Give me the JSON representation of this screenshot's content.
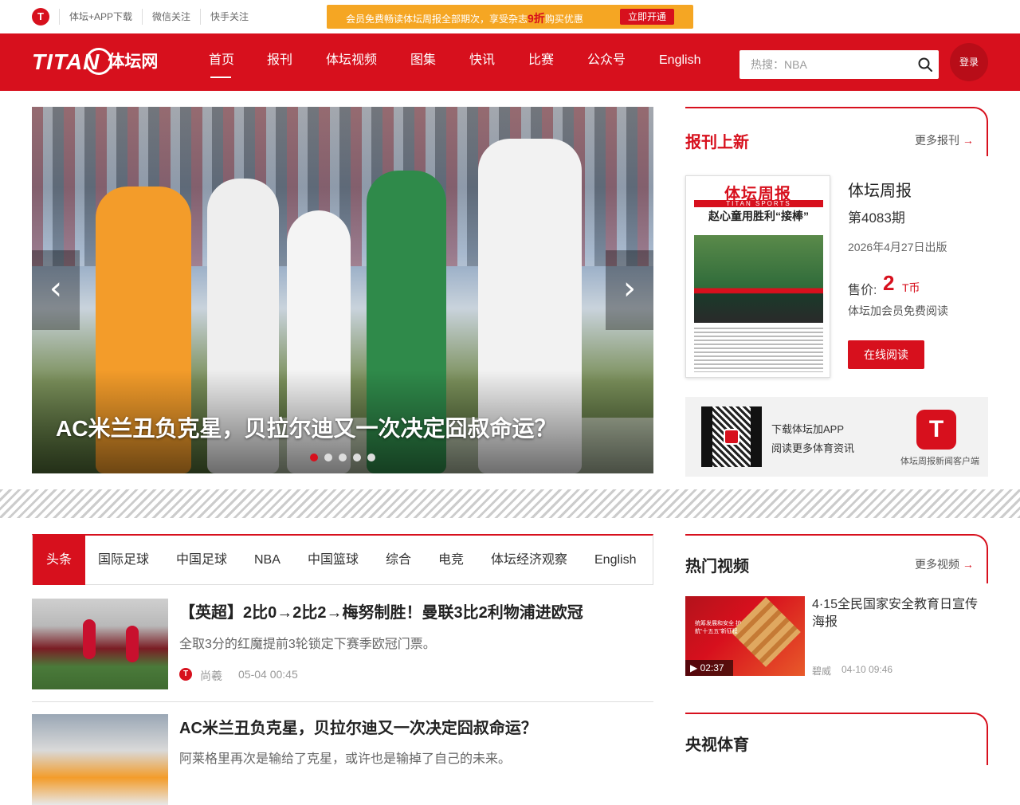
{
  "topbar": {
    "links": [
      "体坛+APP下载",
      "微信关注",
      "快手关注"
    ],
    "promo": {
      "text_before": "会员免费畅读体坛周报全部期次，享受杂志",
      "highlight": "9折",
      "text_after": "购买优惠",
      "button": "立即开通"
    }
  },
  "header": {
    "logo_en": "TITAN",
    "logo_cn": "体坛网",
    "nav": [
      "首页",
      "报刊",
      "体坛视频",
      "图集",
      "快讯",
      "比赛",
      "公众号",
      "English"
    ],
    "active_nav": "首页",
    "search_placeholder": "热搜：NBA",
    "login": "登录"
  },
  "hero": {
    "title": "AC米兰丑负克星，贝拉尔迪又一次决定囧叔命运？",
    "prev_arrow": "‹",
    "next_arrow": "›",
    "slide_count": 5,
    "active_slide": 1
  },
  "magazine_panel": {
    "title": "报刊上新",
    "more": "更多报刊",
    "cover": {
      "masthead": "体坛周报",
      "sub": "TITAN SPORTS",
      "headline": "赵心童用胜利“接棒”"
    },
    "name": "体坛周报",
    "issue": "第4083期",
    "date": "2026年4月27日出版",
    "price_label": "售价:",
    "price": "2",
    "price_unit": "T币",
    "free_note": "体坛加会员免费阅读",
    "read_button": "在线阅读"
  },
  "app_promo": {
    "line1": "下载体坛加APP",
    "line2": "阅读更多体育资讯",
    "icon_letter": "T",
    "caption": "体坛周报新闻客户端"
  },
  "tabs": [
    "头条",
    "国际足球",
    "中国足球",
    "NBA",
    "中国篮球",
    "综合",
    "电竞",
    "体坛经济观察",
    "English"
  ],
  "articles": [
    {
      "title": "【英超】2比0→2比2→梅努制胜！曼联3比2利物浦进欧冠",
      "summary": "全取3分的红魔提前3轮锁定下赛季欧冠门票。",
      "author": "尚羲",
      "time": "05-04 00:45"
    },
    {
      "title": "AC米兰丑负克星，贝拉尔迪又一次决定囧叔命运？",
      "summary": "阿莱格里再次是输给了克星，或许也是输掉了自己的未来。"
    }
  ],
  "video_panel": {
    "title": "热门视频",
    "more": "更多视频",
    "item": {
      "title": "4·15全民国家安全教育日宣传海报",
      "duration": "02:37",
      "author": "碧威",
      "time": "04-10 09:46",
      "thumb_text": "统筹发展和安全 护航“十五五”新征程"
    }
  },
  "cctv_panel": {
    "title": "央视体育"
  },
  "colors": {
    "brand_red": "#d7101d",
    "promo_orange": "#f5a623"
  }
}
